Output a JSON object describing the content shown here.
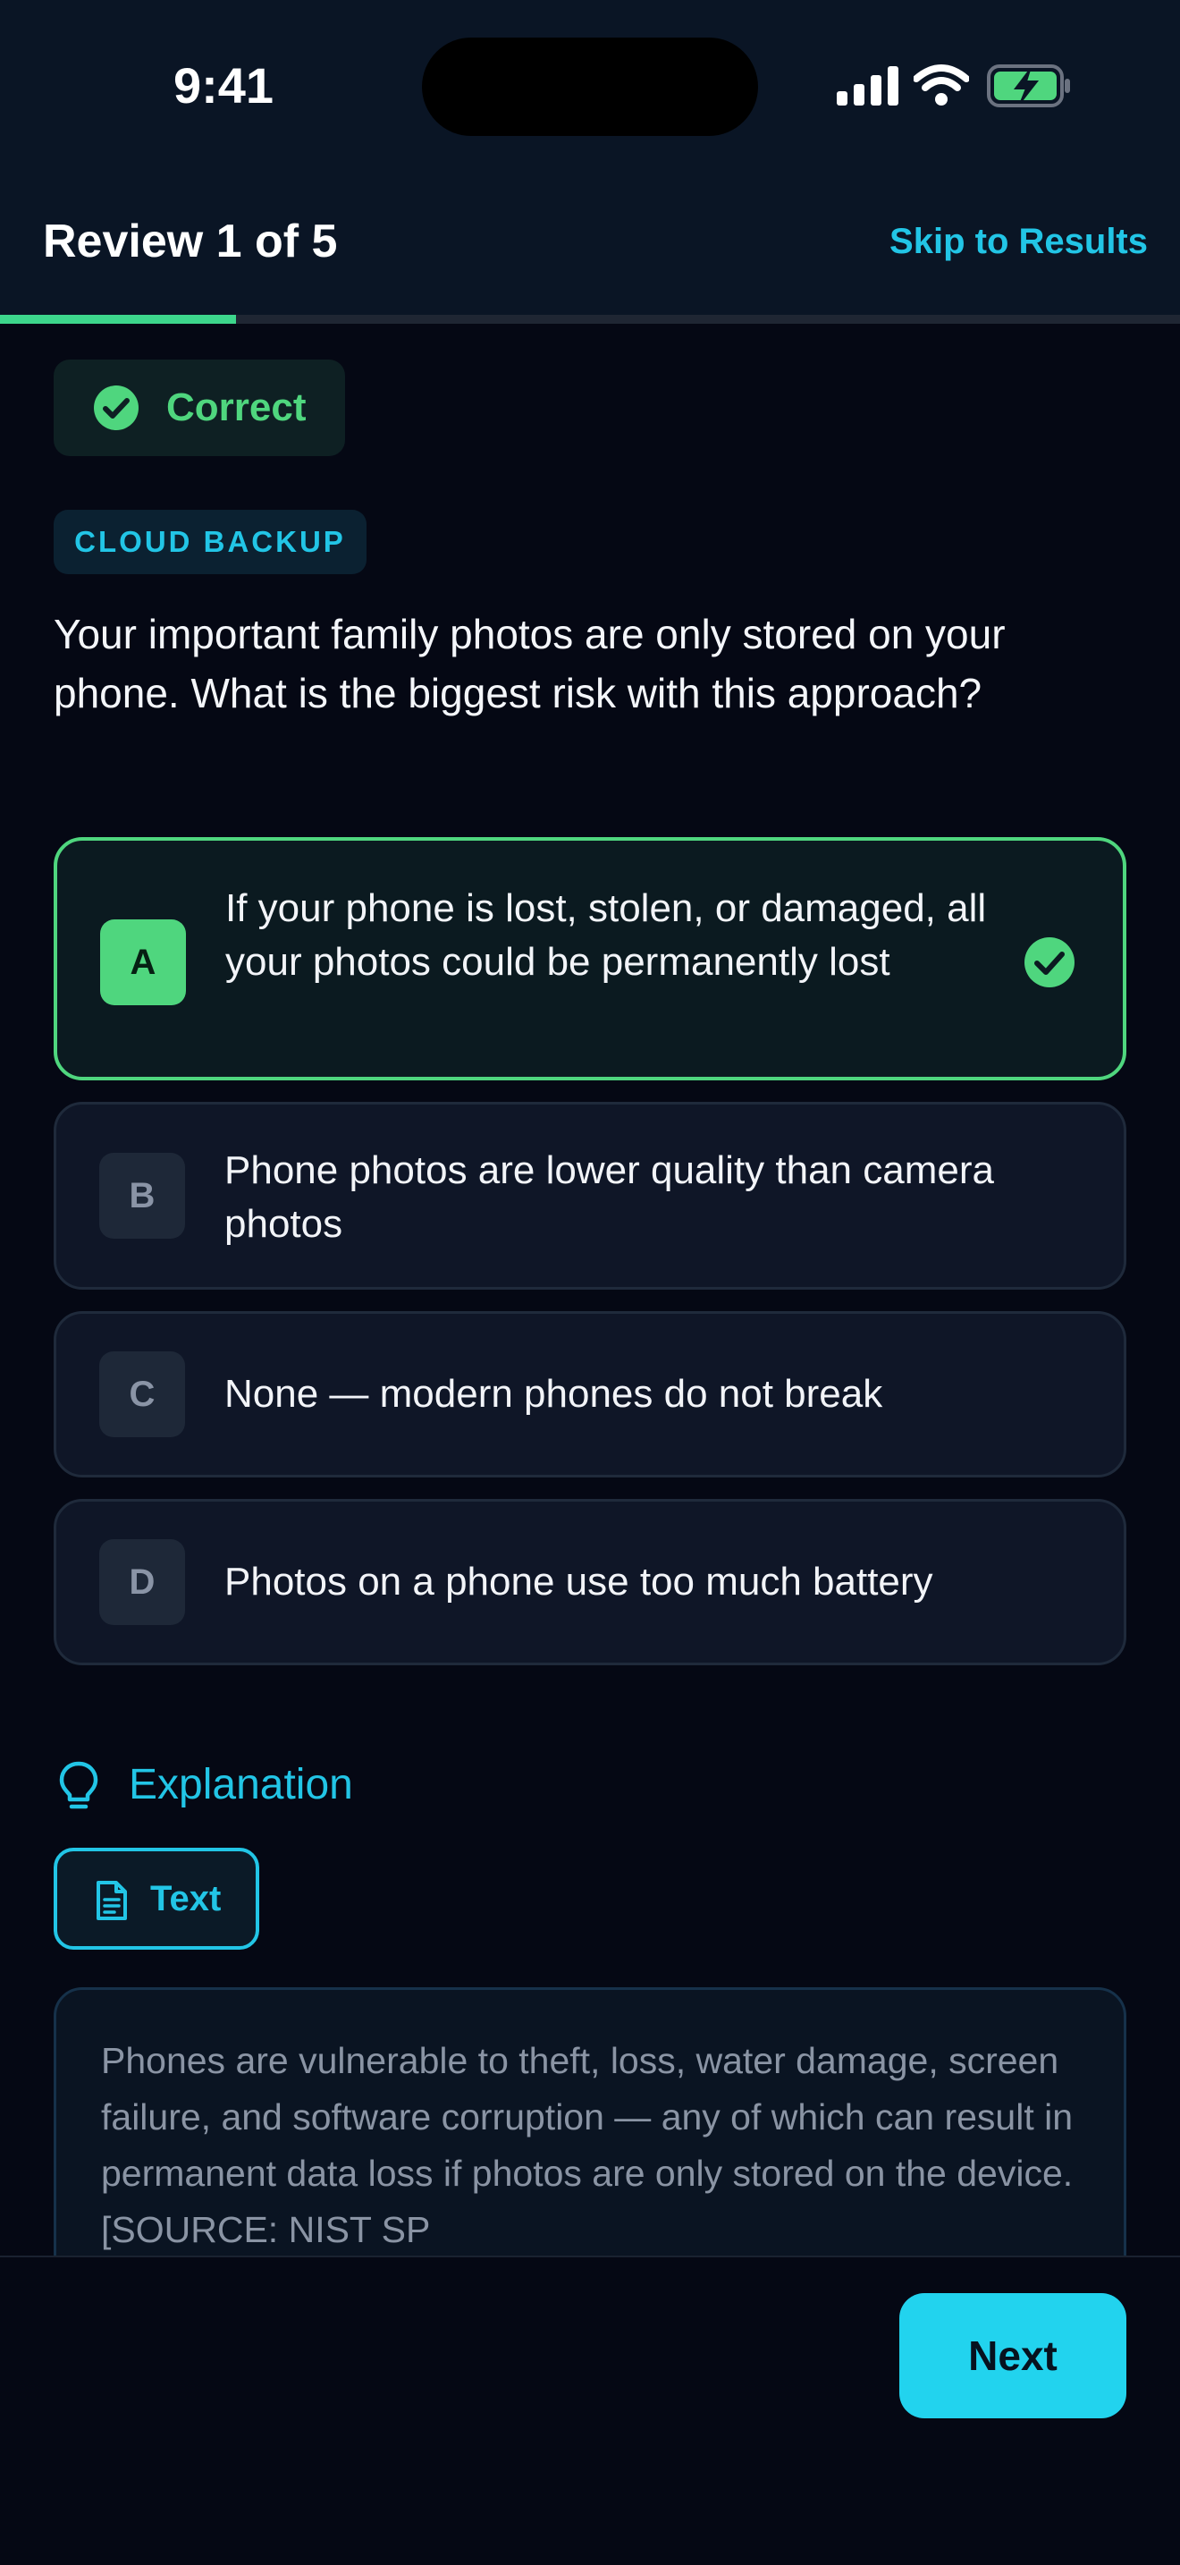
{
  "status_bar": {
    "time": "9:41"
  },
  "header": {
    "title": "Review 1 of 5",
    "skip_label": "Skip to Results",
    "progress_percent": 20
  },
  "result": {
    "label": "Correct"
  },
  "question": {
    "category": "CLOUD BACKUP",
    "text": "Your important family photos are only stored on your phone. What is the biggest risk with this approach?",
    "options": [
      {
        "letter": "A",
        "text": "If your phone is lost, stolen, or damaged, all your photos could be permanently lost",
        "state": "correct"
      },
      {
        "letter": "B",
        "text": "Phone photos are lower quality than camera photos",
        "state": "default"
      },
      {
        "letter": "C",
        "text": "None — modern phones do not break",
        "state": "default"
      },
      {
        "letter": "D",
        "text": "Photos on a phone use too much battery",
        "state": "default"
      }
    ]
  },
  "explanation": {
    "heading": "Explanation",
    "tab_label": "Text",
    "body": "Phones are vulnerable to theft, loss, water damage, screen failure, and software corruption — any of which can result in permanent data loss if photos are only stored on the device. [SOURCE: NIST SP"
  },
  "footer": {
    "next_label": "Next"
  },
  "colors": {
    "accent": "#22c5e6",
    "success": "#4fd67e",
    "background": "#050814"
  },
  "icons": [
    "signal-icon",
    "wifi-icon",
    "battery-charging-icon",
    "check-circle-icon",
    "lightbulb-icon",
    "document-icon"
  ]
}
